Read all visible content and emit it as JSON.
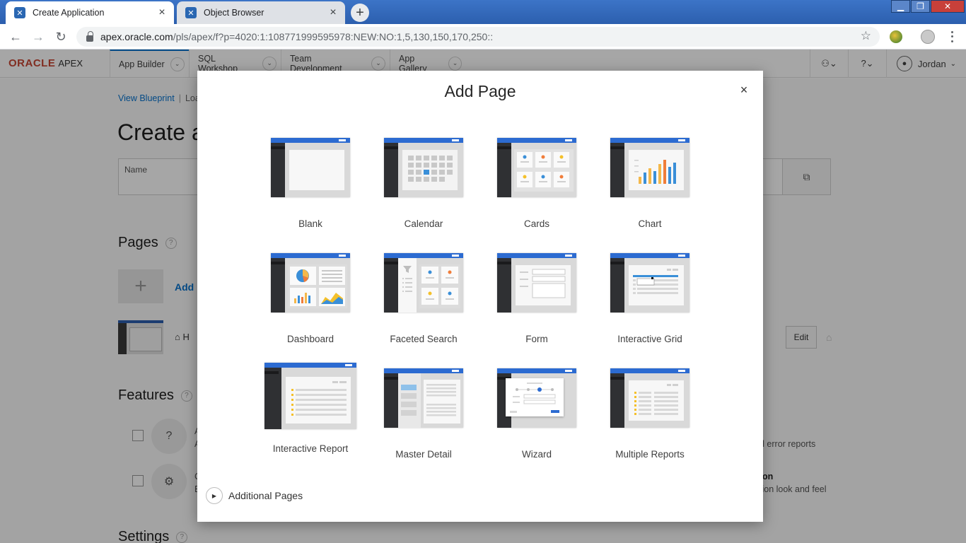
{
  "browser": {
    "tabs": [
      {
        "title": "Create Application",
        "active": true
      },
      {
        "title": "Object Browser",
        "active": false
      }
    ],
    "new_tab_label": "+",
    "url_host": "apex.oracle.com",
    "url_path": "/pls/apex/f?p=4020:1:108771999595978:NEW:NO:1,5,130,150,170,250::"
  },
  "apex_header": {
    "brand_oracle": "ORACLE",
    "brand_apex": "APEX",
    "nav": [
      {
        "label": "App Builder",
        "current": true
      },
      {
        "label": "SQL Workshop",
        "current": false
      },
      {
        "label": "Team Development",
        "current": false
      },
      {
        "label": "App Gallery",
        "current": false
      }
    ],
    "user_name": "Jordan"
  },
  "background_page": {
    "breadcrumb_link": "View Blueprint",
    "breadcrumb_next": "Load",
    "title": "Create a",
    "name_label": "Name",
    "pages_heading": "Pages",
    "add_link": "Add",
    "home_label": "H",
    "edit_label": "Edit",
    "features_heading": "Features",
    "settings_heading": "Settings",
    "feature_rows": [
      {
        "left_text": "A",
        "left_sub": "A",
        "right_text": "d error reports"
      },
      {
        "left_text": "C",
        "left_sub": "E",
        "right_text_strong": "on",
        "right_text": "tion look and feel"
      }
    ]
  },
  "modal": {
    "title": "Add Page",
    "close_label": "×",
    "tiles": [
      {
        "label": "Blank",
        "icon": "blank-page-icon"
      },
      {
        "label": "Calendar",
        "icon": "calendar-page-icon"
      },
      {
        "label": "Cards",
        "icon": "cards-page-icon"
      },
      {
        "label": "Chart",
        "icon": "chart-page-icon"
      },
      {
        "label": "Dashboard",
        "icon": "dashboard-page-icon"
      },
      {
        "label": "Faceted Search",
        "icon": "faceted-search-page-icon"
      },
      {
        "label": "Form",
        "icon": "form-page-icon"
      },
      {
        "label": "Interactive Grid",
        "icon": "interactive-grid-page-icon"
      },
      {
        "label": "Interactive Report",
        "icon": "interactive-report-page-icon"
      },
      {
        "label": "Master Detail",
        "icon": "master-detail-page-icon"
      },
      {
        "label": "Wizard",
        "icon": "wizard-page-icon"
      },
      {
        "label": "Multiple Reports",
        "icon": "multiple-reports-page-icon"
      }
    ],
    "additional_pages_label": "Additional Pages"
  },
  "colors": {
    "apex_blue": "#2c6bd1",
    "oracle_red": "#c74634",
    "link_blue": "#0572ce"
  }
}
